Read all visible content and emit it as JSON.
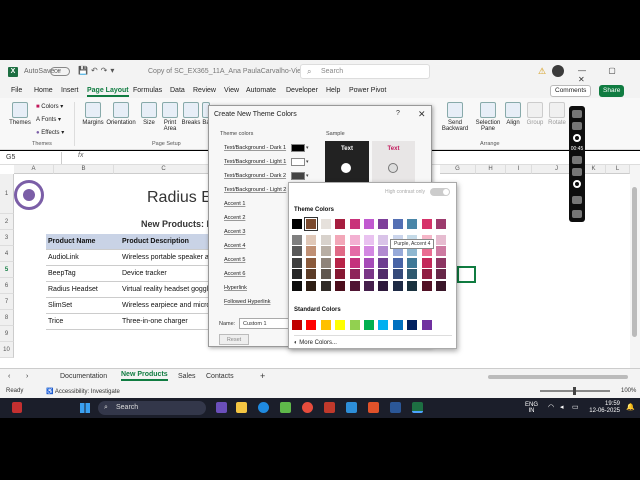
{
  "titlebar": {
    "autosave": "AutoSave",
    "autosave_state": "Off",
    "doc_name": "Copy of SC_EX365_11A_Ana PaulaCarvalho-Vie...",
    "search_placeholder": "Search",
    "window_controls": "—  ▢  ✕"
  },
  "menu": {
    "tabs": [
      "File",
      "Home",
      "Insert",
      "Page Layout",
      "Formulas",
      "Data",
      "Review",
      "View",
      "Automate",
      "Developer",
      "Help",
      "Power Pivot"
    ],
    "comments": "Comments",
    "share": "Share"
  },
  "ribbon": {
    "themes": "Themes",
    "colors": "Colors",
    "fonts": "Fonts",
    "effects": "Effects",
    "themes_group": "Themes",
    "margins": "Margins",
    "orientation": "Orientation",
    "size": "Size",
    "print_area": "Print Area",
    "breaks": "Breaks",
    "background": "Ba",
    "page_setup_group": "Page Setup",
    "send_backward": "Send Backward",
    "selection_pane": "Selection Pane",
    "align": "Align",
    "group": "Group",
    "rotate": "Rotate",
    "arrange_group": "Arrange"
  },
  "formula_bar": {
    "name_box": "G5",
    "fx": "fx"
  },
  "sheet": {
    "columns": [
      "A",
      "B",
      "C",
      "D",
      "E",
      "F",
      "G",
      "H",
      "I",
      "J",
      "K",
      "L"
    ],
    "rows": [
      "1",
      "2",
      "3",
      "4",
      "5",
      "6",
      "7",
      "8",
      "9",
      "10"
    ],
    "big_title": "Radius E",
    "subtitle": "New Products: P",
    "table_header": [
      "Product Name",
      "Product Description"
    ],
    "table_rows": [
      [
        "AudioLink",
        "Wireless portable speaker and"
      ],
      [
        "BeepTag",
        "Device tracker"
      ],
      [
        "Radius Headset",
        "Virtual reality headset goggles"
      ],
      [
        "SlimSet",
        "Wireless earpiece and micro"
      ],
      [
        "Trice",
        "Three-in-one charger"
      ]
    ]
  },
  "sheet_tabs": [
    "Documentation",
    "New Products",
    "Sales",
    "Contacts"
  ],
  "sheet_tabs_active": "New Products",
  "status": {
    "ready": "Ready",
    "accessibility": "Accessibility: Investigate",
    "zoom": "100%"
  },
  "taskbar": {
    "search": "Search",
    "lang": "ENG",
    "region": "IN",
    "time": "19:59",
    "date": "12-06-2025"
  },
  "recorder": {
    "time": "00:45"
  },
  "dialog": {
    "title": "Create New Theme Colors",
    "help": "?",
    "close": "✕",
    "theme_colors_label": "Theme colors",
    "sample_label": "Sample",
    "items": [
      "Text/Background - Dark 1",
      "Text/Background - Light 1",
      "Text/Background - Dark 2",
      "Text/Background - Light 2",
      "Accent 1",
      "Accent 2",
      "Accent 3",
      "Accent 4",
      "Accent 5",
      "Accent 6",
      "Hyperlink",
      "Followed Hyperlink"
    ],
    "sample_text": "Text",
    "name_label": "Name:",
    "name_value": "Custom 1",
    "reset": "Reset"
  },
  "picker": {
    "high_contrast": "High contrast only",
    "theme_colors_label": "Theme Colors",
    "standard_colors_label": "Standard Colors",
    "tooltip": "Purple, Accent 4",
    "more_colors": "More Colors...",
    "theme_top": [
      "#000000",
      "#7b4a2e",
      "#e6e1dc",
      "#a61e3f",
      "#c9327a",
      "#c15ad0",
      "#7d3f9a",
      "#5470b4",
      "#4a86a8",
      "#d6336a",
      "#9c3b6d"
    ],
    "theme_shades": [
      [
        "#7f7f7f",
        "#595959",
        "#3f3f3f",
        "#262626",
        "#0d0d0d"
      ],
      [
        "#e0c8b8",
        "#c09074",
        "#8a5a3b",
        "#5c3c27",
        "#2e1e14"
      ],
      [
        "#d8d2cc",
        "#b8aea4",
        "#8f847a",
        "#60574f",
        "#302b27"
      ],
      [
        "#f2a7b8",
        "#e06a86",
        "#b82447",
        "#861832",
        "#4c0e1c"
      ],
      [
        "#f3b0d2",
        "#e46ba7",
        "#c4327d",
        "#8e245a",
        "#501433"
      ],
      [
        "#e9c2f0",
        "#d388e2",
        "#a64bb8",
        "#7a3687",
        "#451f4c"
      ],
      [
        "#d9c3e8",
        "#b28ad0",
        "#6e3d90",
        "#512c6a",
        "#2e193c"
      ],
      [
        "#cbd5ec",
        "#97aad9",
        "#4864a6",
        "#354a7a",
        "#1e2a45"
      ],
      [
        "#c6dbe8",
        "#8fb8d1",
        "#3f7896",
        "#2f596f",
        "#1a323f"
      ],
      [
        "#f5b6c8",
        "#ea6d92",
        "#c4285a",
        "#901d42",
        "#521125"
      ],
      [
        "#e6bcd0",
        "#cd7aa1",
        "#8c3562",
        "#672748",
        "#3a1629"
      ]
    ],
    "standard": [
      "#c00000",
      "#ff0000",
      "#ffc000",
      "#ffff00",
      "#92d050",
      "#00b050",
      "#00b0f0",
      "#0070c0",
      "#002060",
      "#7030a0"
    ]
  },
  "colors": {
    "excel_green": "#107c41",
    "table_header_bg": "#c9d3e6",
    "logo_purple": "#7b5ea7"
  }
}
